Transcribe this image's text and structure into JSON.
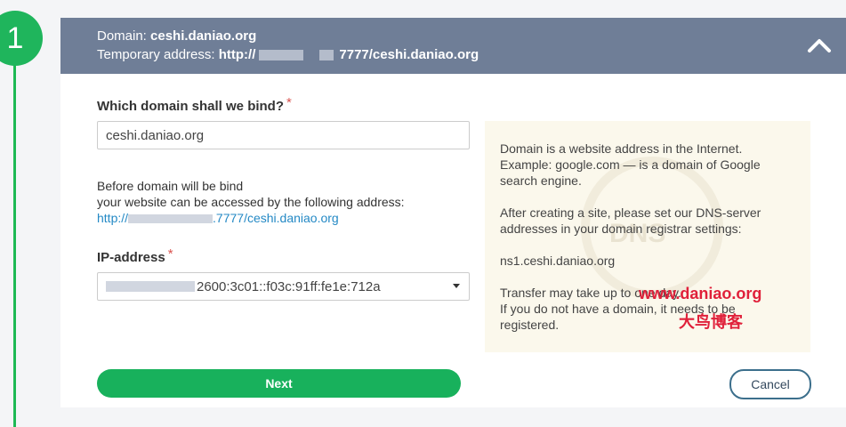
{
  "step": {
    "number": "1"
  },
  "header": {
    "domain_label": "Domain:",
    "domain_value": "ceshi.daniao.org",
    "temp_label": "Temporary address:",
    "temp_prefix": "http://",
    "temp_suffix": "7777/ceshi.daniao.org"
  },
  "form": {
    "domain_question": "Which domain shall we bind?",
    "required_mark": "*",
    "domain_value": "ceshi.daniao.org",
    "before_line1": "Before domain will be bind",
    "before_line2": "your website can be accessed by the following address:",
    "temp_link_prefix": "http://",
    "temp_link_suffix": ".7777/ceshi.daniao.org",
    "ip_label": "IP-address",
    "ip_value": "2600:3c01::f03c:91ff:fe1e:712a"
  },
  "help": {
    "p1_line1": "Domain is a website address in the Internet.",
    "p1_line2": "Example: google.com — is a domain of Google",
    "p1_line3": "search engine.",
    "p2_line1": "After creating a site, please set our DNS-server",
    "p2_line2": "addresses in your domain registrar settings:",
    "ns1": "ns1.ceshi.daniao.org",
    "p3_line1": "Transfer may take up to one day.",
    "p3_line2": "If you do not have a domain, it needs to be",
    "p3_line3": "registered.",
    "watermark_dns": "DNS"
  },
  "watermark": {
    "site": "www.daniao.org",
    "name": "大鸟博客"
  },
  "actions": {
    "next_label": "Next",
    "cancel_label": "Cancel"
  }
}
